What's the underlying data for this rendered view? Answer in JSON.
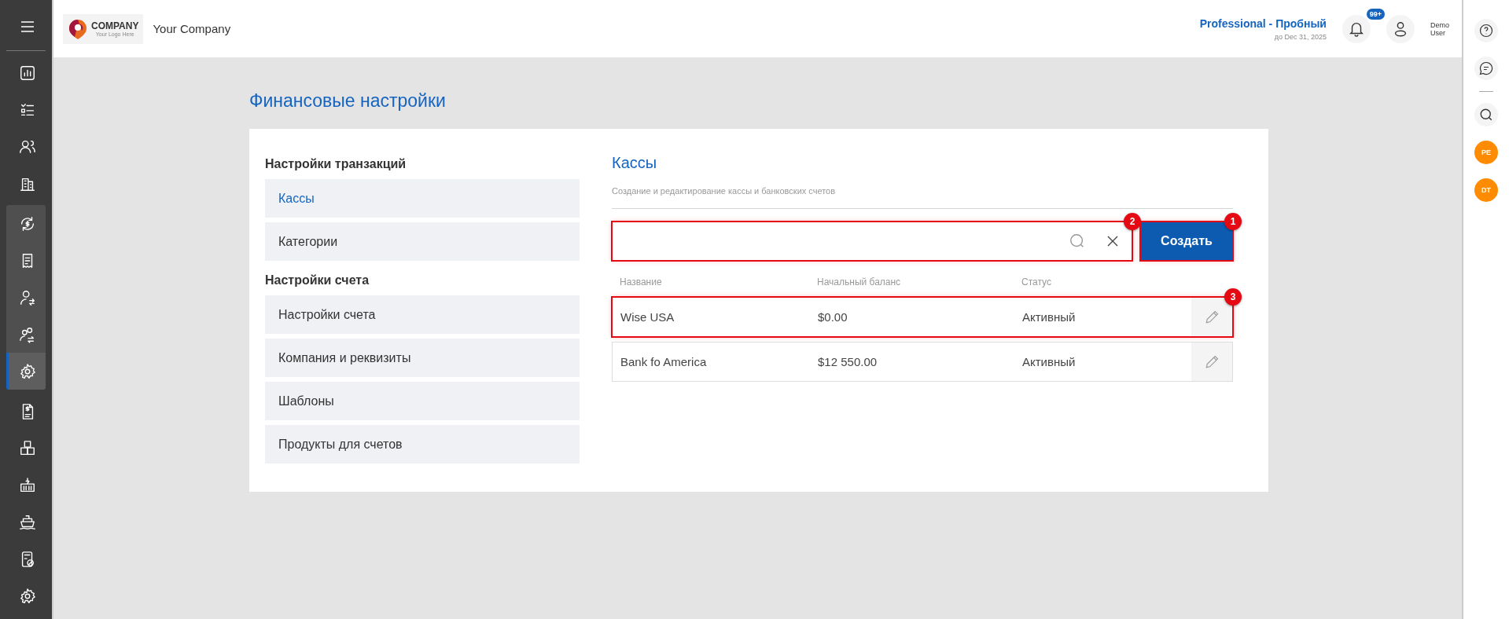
{
  "sidebar": {
    "items": [
      {
        "selected": false,
        "grouped": false
      },
      {
        "selected": false,
        "grouped": false
      },
      {
        "selected": false,
        "grouped": false
      },
      {
        "selected": false,
        "grouped": false
      },
      {
        "selected": false,
        "grouped": true
      },
      {
        "selected": false,
        "grouped": true
      },
      {
        "selected": false,
        "grouped": true
      },
      {
        "selected": false,
        "grouped": true
      },
      {
        "selected": true,
        "grouped": true
      },
      {
        "selected": false,
        "grouped": false
      },
      {
        "selected": false,
        "grouped": false
      },
      {
        "selected": false,
        "grouped": false
      },
      {
        "selected": false,
        "grouped": false
      },
      {
        "selected": false,
        "grouped": false
      },
      {
        "selected": false,
        "grouped": false
      }
    ]
  },
  "header": {
    "logo": {
      "name": "COMPANY",
      "tagline": "Your Logo Here"
    },
    "company": "Your Company",
    "plan": "Professional - Пробный",
    "plan_until": "до Dec 31, 2025",
    "notifications_badge": "99+",
    "user": [
      "Demo",
      "User"
    ]
  },
  "right_bar": {
    "avatars": [
      {
        "initials": "PE",
        "color": "#ff8c00"
      },
      {
        "initials": "DT",
        "color": "#ff8c00"
      }
    ]
  },
  "page_title": "Финансовые настройки",
  "settings_nav": {
    "groups": [
      {
        "title": "Настройки транзакций",
        "items": [
          {
            "label": "Кассы",
            "selected": true
          },
          {
            "label": "Категории",
            "selected": false
          }
        ]
      },
      {
        "title": "Настройки счета",
        "items": [
          {
            "label": "Настройки счета",
            "selected": false
          },
          {
            "label": "Компания и реквизиты",
            "selected": false
          },
          {
            "label": "Шаблоны",
            "selected": false
          },
          {
            "label": "Продукты для счетов",
            "selected": false
          }
        ]
      }
    ]
  },
  "section": {
    "title": "Кассы",
    "subtitle": "Создание и редактирование кассы и банковских счетов",
    "search": {
      "annotation": "2"
    },
    "create_button": {
      "label": "Создать",
      "annotation": "1"
    },
    "table": {
      "columns": [
        "Название",
        "Начальный баланс",
        "Статус"
      ],
      "rows": [
        {
          "cells": [
            "Wise USA",
            "$0.00",
            "Активный"
          ],
          "annotation": "3"
        },
        {
          "cells": [
            "Bank fo America",
            "$12 550.00",
            "Активный"
          ]
        }
      ]
    }
  }
}
